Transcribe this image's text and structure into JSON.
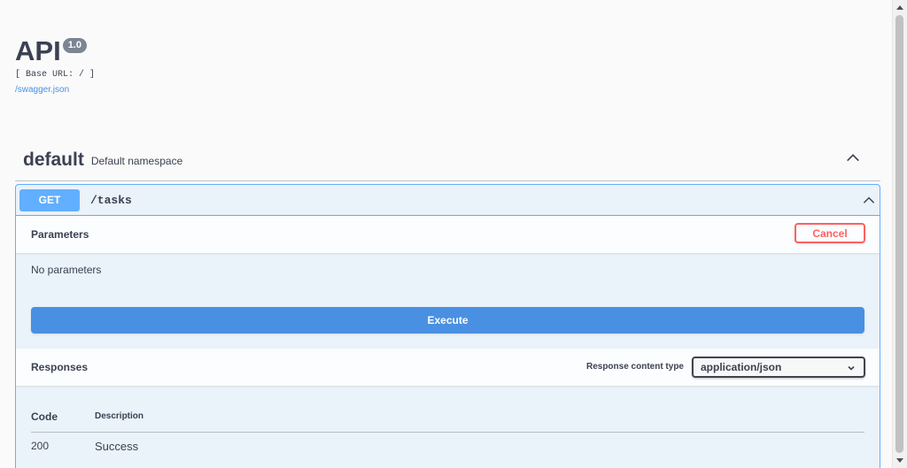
{
  "info": {
    "title": "API",
    "version": "1.0",
    "base_url": "[ Base URL: / ]",
    "spec_link": "/swagger.json"
  },
  "namespace": {
    "name": "default",
    "description": "Default namespace"
  },
  "operation": {
    "method": "GET",
    "path": "/tasks",
    "method_color": "#61affe",
    "parameters": {
      "title": "Parameters",
      "cancel_label": "Cancel",
      "empty_text": "No parameters"
    },
    "execute_label": "Execute",
    "responses": {
      "title": "Responses",
      "content_type_label": "Response content type",
      "content_type_value": "application/json",
      "columns": {
        "code": "Code",
        "description": "Description"
      },
      "rows": [
        {
          "code": "200",
          "description": "Success"
        }
      ]
    }
  },
  "colors": {
    "accent": "#4990e2",
    "cancel": "#ff6060",
    "text": "#3b4151"
  }
}
